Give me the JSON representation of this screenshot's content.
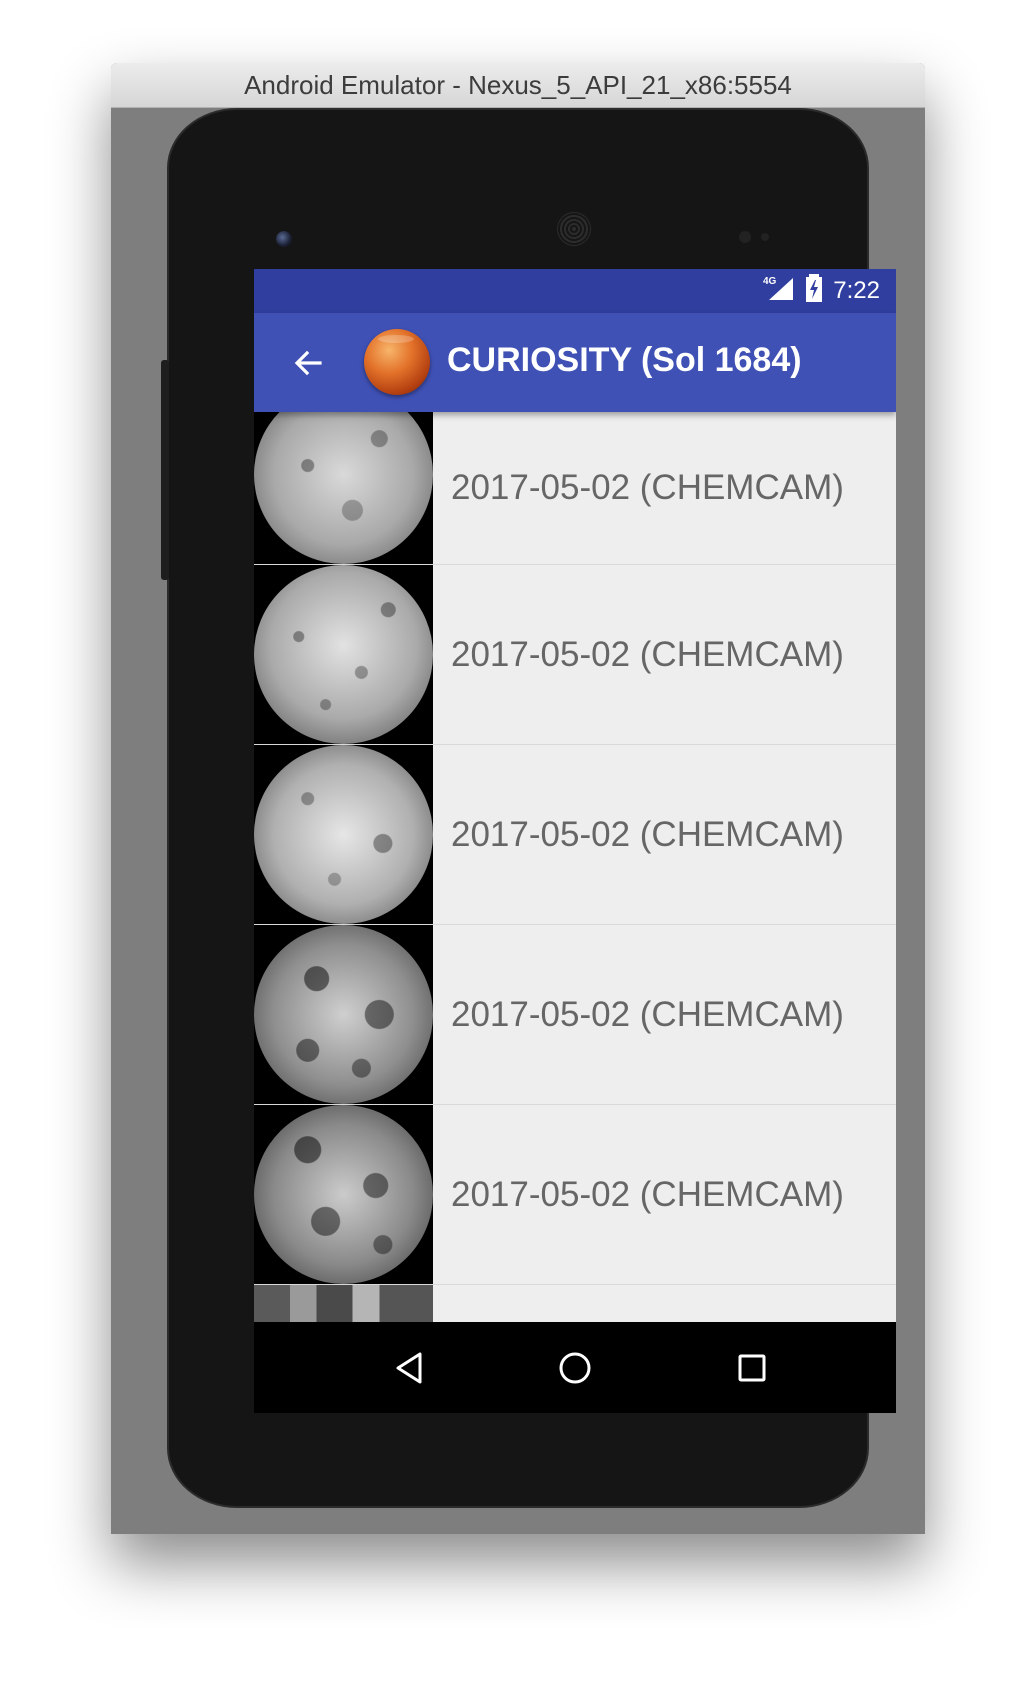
{
  "window": {
    "title": "Android Emulator - Nexus_5_API_21_x86:5554"
  },
  "status_bar": {
    "network": "4G",
    "time": "7:22"
  },
  "app_bar": {
    "title": "CURIOSITY (Sol 1684)"
  },
  "photos": [
    {
      "label": "2017-05-02 (CHEMCAM)"
    },
    {
      "label": "2017-05-02 (CHEMCAM)"
    },
    {
      "label": "2017-05-02 (CHEMCAM)"
    },
    {
      "label": "2017-05-02 (CHEMCAM)"
    },
    {
      "label": "2017-05-02 (CHEMCAM)"
    }
  ],
  "icons": {
    "back": "arrow-left-icon",
    "logo": "mars-planet-icon",
    "nav_back": "triangle-back-icon",
    "nav_home": "circle-home-icon",
    "nav_recents": "square-recents-icon"
  },
  "colors": {
    "status_bar": "#303f9f",
    "app_bar": "#3f51b5",
    "list_background": "#eeeeee",
    "label_text": "#666666"
  }
}
